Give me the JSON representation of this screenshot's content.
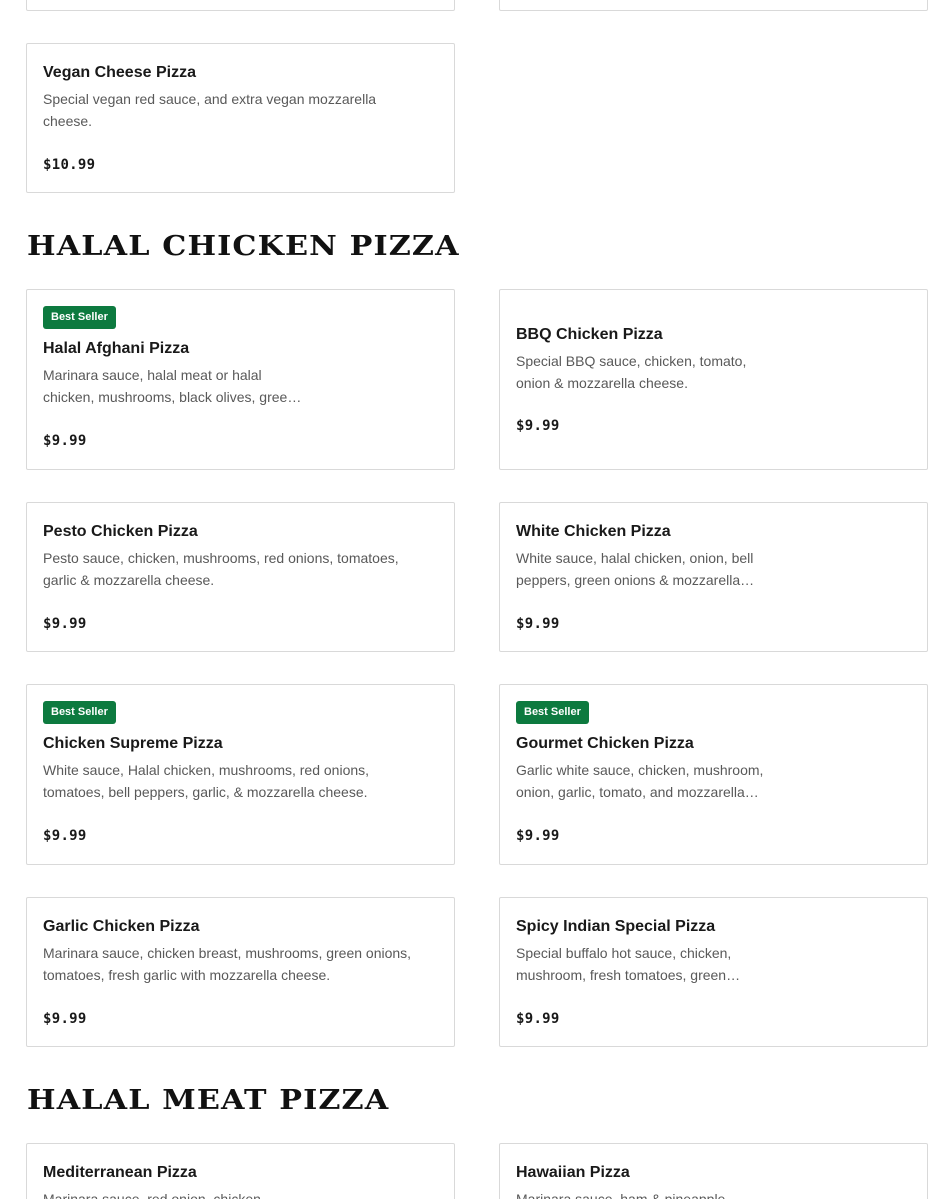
{
  "top_cards_partial": [
    {
      "side": "left"
    },
    {
      "side": "right"
    }
  ],
  "vegan_cheese": {
    "name": "Vegan Cheese Pizza",
    "description": "Special vegan red sauce, and extra vegan mozzarella cheese.",
    "price": "$10.99"
  },
  "sections": {
    "halal_chicken": {
      "title": "HALAL CHICKEN PIZZA",
      "items": [
        {
          "badge": "Best Seller",
          "name": "Halal Afghani Pizza",
          "description": "Marinara sauce, halal meat or halal chicken, mushrooms, black olives, green peppers, onion & mozzarella cheese.",
          "price": "$9.99"
        },
        {
          "badge": "",
          "name": "BBQ Chicken Pizza",
          "description": "Special BBQ sauce, chicken, tomato, onion & mozzarella cheese.",
          "price": "$9.99"
        },
        {
          "badge": "",
          "name": "Pesto Chicken Pizza",
          "description": "Pesto sauce, chicken, mushrooms, red onions, tomatoes, garlic & mozzarella cheese.",
          "price": "$9.99"
        },
        {
          "badge": "",
          "name": "White Chicken Pizza",
          "description": "White sauce, halal chicken, onion, bell peppers, green onions & mozzarella cheese.",
          "price": "$9.99"
        },
        {
          "badge": "Best Seller",
          "name": "Chicken Supreme Pizza",
          "description": "White sauce, Halal chicken, mushrooms, red onions, tomatoes, bell peppers, garlic, & mozzarella cheese.",
          "price": "$9.99"
        },
        {
          "badge": "Best Seller",
          "name": "Gourmet Chicken Pizza",
          "description": "Garlic white sauce, chicken, mushroom, onion, garlic, tomato, and mozzarella cheese.",
          "price": "$9.99"
        },
        {
          "badge": "",
          "name": "Garlic Chicken Pizza",
          "description": "Marinara sauce, chicken breast, mushrooms, green onions, tomatoes, fresh garlic with mozzarella cheese.",
          "price": "$9.99"
        },
        {
          "badge": "",
          "name": "Spicy Indian Special Pizza",
          "description": "Special buffalo hot sauce, chicken, mushroom, fresh tomatoes, green onions & mozzarella cheese.",
          "price": "$9.99"
        }
      ]
    },
    "halal_meat": {
      "title": "HALAL MEAT PIZZA",
      "items": [
        {
          "name": "Mediterranean Pizza",
          "description": "Marinara sauce, red onion, chicken"
        },
        {
          "name": "Hawaiian Pizza",
          "description": "Marinara sauce, ham & pineapple"
        }
      ]
    }
  }
}
